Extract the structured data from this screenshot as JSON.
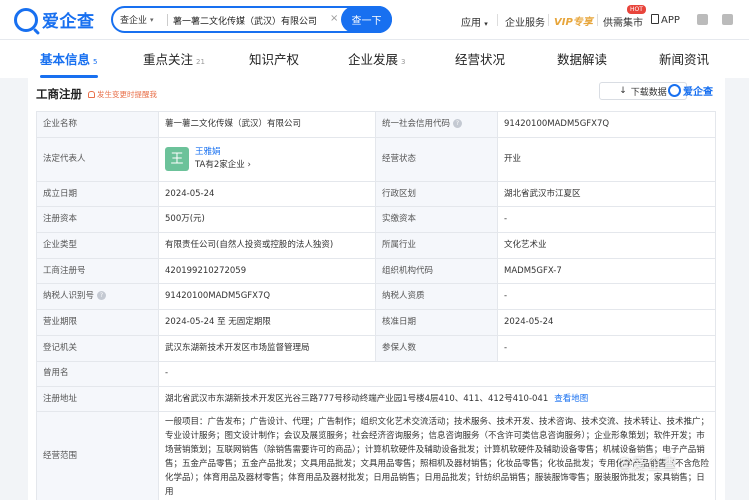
{
  "header": {
    "logo_text": "爱企查",
    "search": {
      "scope": "查企业",
      "value": "薯一薯二文化传媒（武汉）有限公司",
      "clear": "×",
      "button": "查一下"
    },
    "nav": {
      "apps": "应用",
      "services": "企业服务",
      "vip": "VIP专享",
      "hot_badge": "HOT",
      "supply": "供需集市",
      "app": "APP"
    }
  },
  "tabs": [
    {
      "label": "基本信息",
      "count": "5"
    },
    {
      "label": "重点关注",
      "count": "21"
    },
    {
      "label": "知识产权",
      "count": ""
    },
    {
      "label": "企业发展",
      "count": "3"
    },
    {
      "label": "经营状况",
      "count": ""
    },
    {
      "label": "数据解读",
      "count": ""
    },
    {
      "label": "新闻资讯",
      "count": ""
    }
  ],
  "panel": {
    "title": "工商注册",
    "notify": "发生变更时提醒我",
    "download": "下载数据",
    "brand": "爱企查"
  },
  "registry": {
    "company_name_label": "企业名称",
    "company_name": "薯一薯二文化传媒（武汉）有限公司",
    "credit_code_label": "统一社会信用代码",
    "credit_code": "91420100MADM5GFX7Q",
    "legal_rep_label": "法定代表人",
    "legal_rep_avatar": "王",
    "legal_rep_name": "王雅娟",
    "legal_rep_sub": "TA有2家企业",
    "status_label": "经营状态",
    "status": "开业",
    "founded_label": "成立日期",
    "founded": "2024-05-24",
    "region_label": "行政区划",
    "region": "湖北省武汉市江夏区",
    "capital_label": "注册资本",
    "capital": "500万(元)",
    "paid_capital_label": "实缴资本",
    "paid_capital": "-",
    "type_label": "企业类型",
    "type": "有限责任公司(自然人投资或控股的法人独资)",
    "industry_label": "所属行业",
    "industry": "文化艺术业",
    "reg_no_label": "工商注册号",
    "reg_no": "420199210272059",
    "org_code_label": "组织机构代码",
    "org_code": "MADM5GFX-7",
    "taxpayer_id_label": "纳税人识别号",
    "taxpayer_id": "91420100MADM5GFX7Q",
    "taxpayer_quali_label": "纳税人资质",
    "taxpayer_quali": "-",
    "term_label": "营业期限",
    "term": "2024-05-24 至 无固定期限",
    "approval_label": "核准日期",
    "approval": "2024-05-24",
    "authority_label": "登记机关",
    "authority": "武汉东湖新技术开发区市场监督管理局",
    "insured_label": "参保人数",
    "insured": "-",
    "former_name_label": "曾用名",
    "former_name": "-",
    "address_label": "注册地址",
    "address": "湖北省武汉市东湖新技术开发区光谷三路777号移动终端产业园1号楼4层410、411、412号410-041",
    "map_link": "查看地图",
    "scope_label": "经营范围",
    "scope": "一般项目：广告发布；广告设计、代理；广告制作；组织文化艺术交流活动；技术服务、技术开发、技术咨询、技术交流、技术转让、技术推广；专业设计服务；图文设计制作；会议及展览服务；社会经济咨询服务；信息咨询服务（不含许可类信息咨询服务）；企业形象策划；软件开发；市场营销策划；互联网销售（除销售需要许可的商品）；计算机软硬件及辅助设备批发；计算机软硬件及辅助设备零售；机械设备销售；电子产品销售；五金产品零售；五金产品批发；文具用品批发；文具用品零售；照相机及器材销售；化妆品零售；化妆品批发；专用化学产品销售（不含危险化学品）；体育用品及器材零售；体育用品及器材批发；日用品销售；日用品批发；针纺织品销售；服装服饰零售；服装服饰批发；家具销售；日用"
  },
  "watermark": "@爱企查"
}
